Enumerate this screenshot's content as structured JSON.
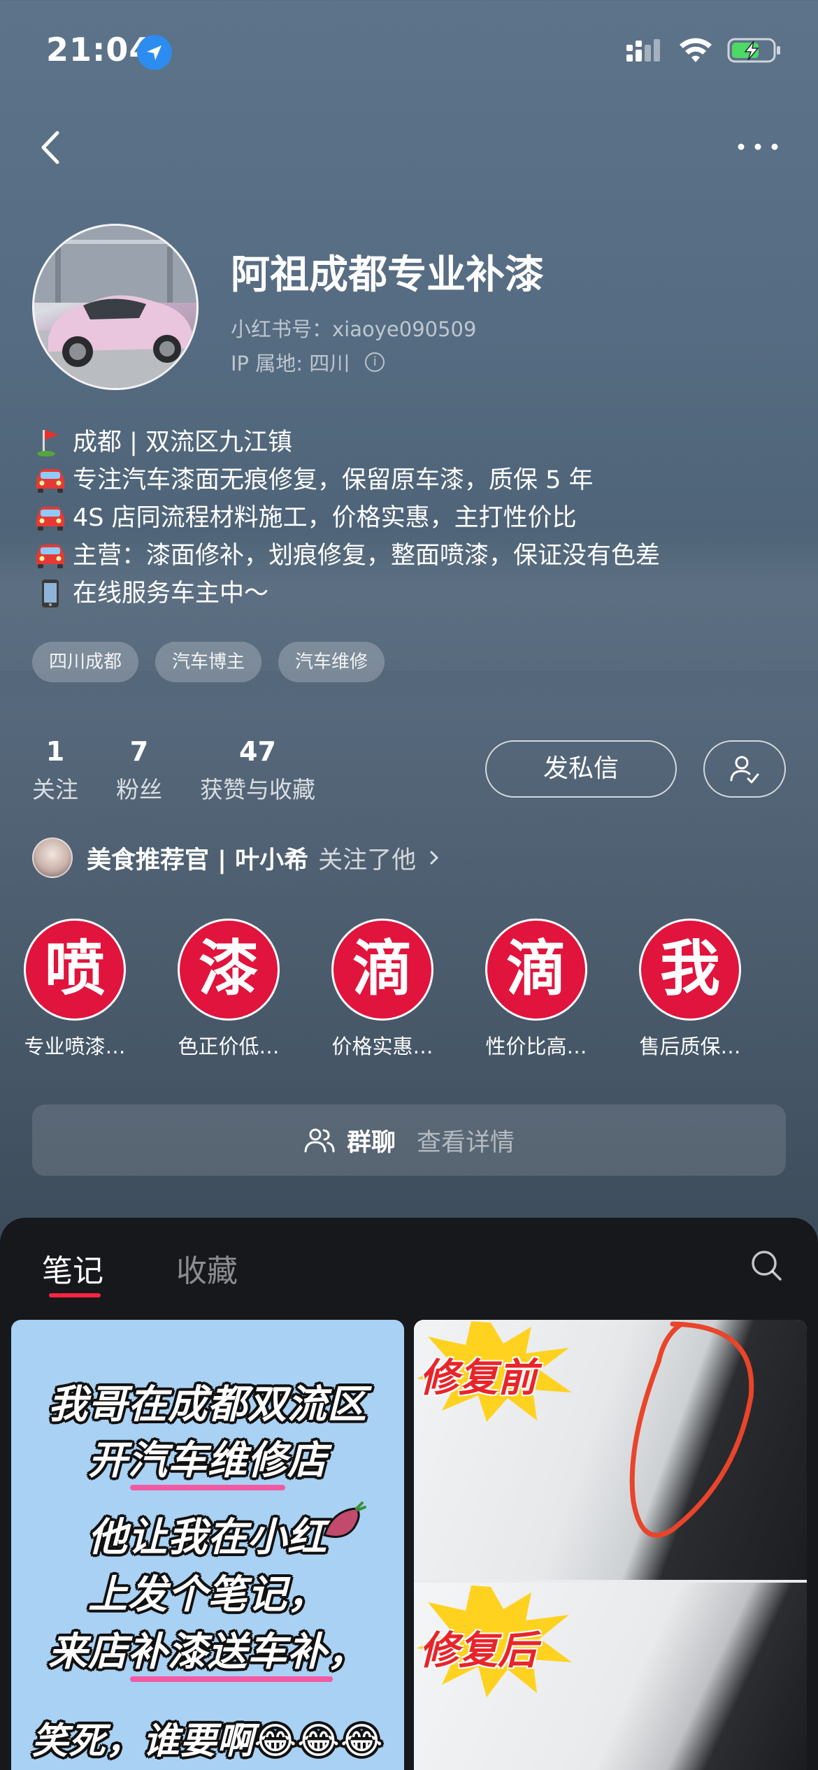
{
  "status_bar": {
    "time": "21:04"
  },
  "profile": {
    "name": "阿祖成都专业补漆",
    "id_line": "小红书号：xiaoye090509",
    "ip_line": "IP 属地: 四川",
    "bio": [
      {
        "emoji": "⛳",
        "text": "成都 | 双流区九江镇"
      },
      {
        "emoji": "🚘",
        "text": "专注汽车漆面无痕修复，保留原车漆，质保 5 年"
      },
      {
        "emoji": "🚘",
        "text": "4S 店同流程材料施工，价格实惠，主打性价比"
      },
      {
        "emoji": "🚘",
        "text": "主营：漆面修补，划痕修复，整面喷漆，保证没有色差"
      },
      {
        "emoji": "📱",
        "text": "在线服务车主中～"
      }
    ],
    "tags": [
      "四川成都",
      "汽车博主",
      "汽车维修"
    ]
  },
  "stats": [
    {
      "num": "1",
      "label": "关注"
    },
    {
      "num": "7",
      "label": "粉丝"
    },
    {
      "num": "47",
      "label": "获赞与收藏"
    }
  ],
  "actions": {
    "message_label": "发私信"
  },
  "followed_by": {
    "name": "美食推荐官 | 叶小希",
    "action": "关注了他"
  },
  "collections": [
    {
      "char": "喷",
      "label": "专业喷漆…"
    },
    {
      "char": "漆",
      "label": "色正价低…"
    },
    {
      "char": "滴",
      "label": "价格实惠…"
    },
    {
      "char": "滴",
      "label": "性价比高…"
    },
    {
      "char": "我",
      "label": "售后质保…"
    }
  ],
  "group_chat": {
    "title": "群聊",
    "detail": "查看详情"
  },
  "tabs": {
    "notes": "笔记",
    "favorites": "收藏"
  },
  "posts": {
    "card1_lines": [
      "我哥在成都双流区",
      "开汽车维修店",
      "他让我在小红",
      "上发个笔记，",
      "来店补漆送车补，",
      "笑死，谁要啊😂😂😂"
    ],
    "card2_before": "修复前",
    "card2_after": "修复后"
  },
  "colors": {
    "accent": "#ff2442",
    "collection_red": "#e0143c",
    "panel_bg": "#17181c"
  }
}
